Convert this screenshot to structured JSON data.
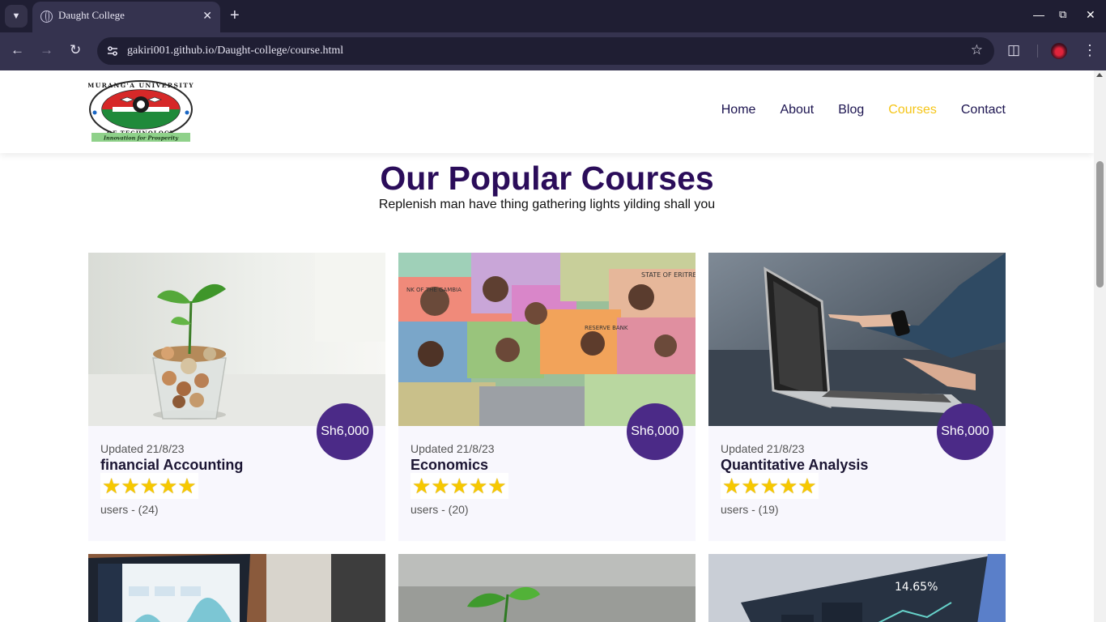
{
  "browser": {
    "tab_title": "Daught College",
    "url": "gakiri001.github.io/Daught-college/course.html"
  },
  "nav": {
    "items": [
      "Home",
      "About",
      "Blog",
      "Courses",
      "Contact"
    ],
    "active": "Courses"
  },
  "logo": {
    "text_top": "MURANG'A UNIVERSITY",
    "text_bottom": "OF TECHNOLOGY",
    "motto": "Innovation for Prosperity"
  },
  "section": {
    "title": "Our Popular Courses",
    "subtitle": "Replenish man have thing gathering lights yilding shall you"
  },
  "courses": [
    {
      "updated": "Updated 21/8/23",
      "name": "financial Accounting",
      "price": "Sh6,000",
      "rating": 5,
      "users": "users - (24)",
      "image": "coins-plant"
    },
    {
      "updated": "Updated 21/8/23",
      "name": "Economics",
      "price": "Sh6,000",
      "rating": 5,
      "users": "users - (20)",
      "image": "african-banknotes"
    },
    {
      "updated": "Updated 21/8/23",
      "name": "Quantitative Analysis",
      "price": "Sh6,000",
      "rating": 5,
      "users": "users - (19)",
      "image": "laptop-hand"
    }
  ],
  "colors": {
    "accent": "#4b2a87",
    "active_nav": "#f5c518",
    "heading": "#2b0d5a",
    "star": "#f6c800"
  }
}
